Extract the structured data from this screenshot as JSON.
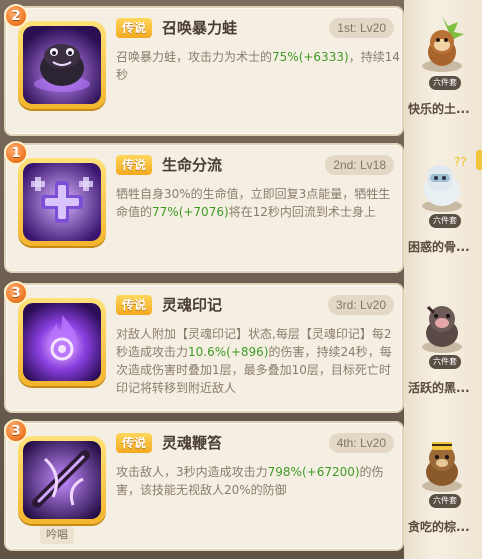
{
  "skills": [
    {
      "level": "2",
      "tag": "传说",
      "name": "召唤暴力蛙",
      "rank": "1st: Lv20",
      "desc_parts": [
        "召唤暴力蛙，攻击力为术士的",
        "75%",
        "(+6333)",
        "，持续14秒"
      ],
      "icon": "violent-frog-icon",
      "accent": "#6a2fb5"
    },
    {
      "level": "1",
      "tag": "传说",
      "name": "生命分流",
      "rank": "2nd: Lv18",
      "desc_parts": [
        "牺牲自身30%的生命值，立即回复3点能量，牺牲生命值的",
        "77%",
        "(+7076)",
        "将在12秒内回流到术士身上"
      ],
      "icon": "life-tap-icon",
      "accent": "#7b3fc4"
    },
    {
      "level": "3",
      "tag": "传说",
      "name": "灵魂印记",
      "rank": "3rd: Lv20",
      "desc_parts": [
        "对敌人附加【灵魂印记】状态,每层【灵魂印记】每2秒造成攻击力",
        "10.6%",
        "(+896)",
        "的伤害，持续24秒，每次造成伤害时叠加1层，最多叠加10层，目标死亡时印记将转移到附近敌人"
      ],
      "icon": "soul-mark-icon",
      "accent": "#6a24b8"
    },
    {
      "level": "3",
      "tag": "传说",
      "name": "灵魂鞭笞",
      "rank": "4th: Lv20",
      "desc_parts": [
        "攻击敌人，3秒内造成攻击力",
        "798%",
        "(+67200)",
        "的伤害，该技能无视敌人20%的防御"
      ],
      "icon": "soul-lash-icon",
      "accent": "#5a1fa8",
      "chant": "吟唱"
    }
  ],
  "pets": [
    {
      "name": "快乐的土...",
      "badge": "六件套",
      "icon": "happy-monkey-icon"
    },
    {
      "name": "困惑的骨...",
      "badge": "六件套",
      "icon": "confused-yeti-icon"
    },
    {
      "name": "活跃的黑...",
      "badge": "六件套",
      "icon": "active-boar-icon"
    },
    {
      "name": "贪吃的棕...",
      "badge": "六件套",
      "icon": "greedy-bear-icon"
    }
  ],
  "colors": {
    "highlight": "#3f9b26",
    "tag_gold": "#f4a91f",
    "badge_orange": "#f07d2a"
  }
}
